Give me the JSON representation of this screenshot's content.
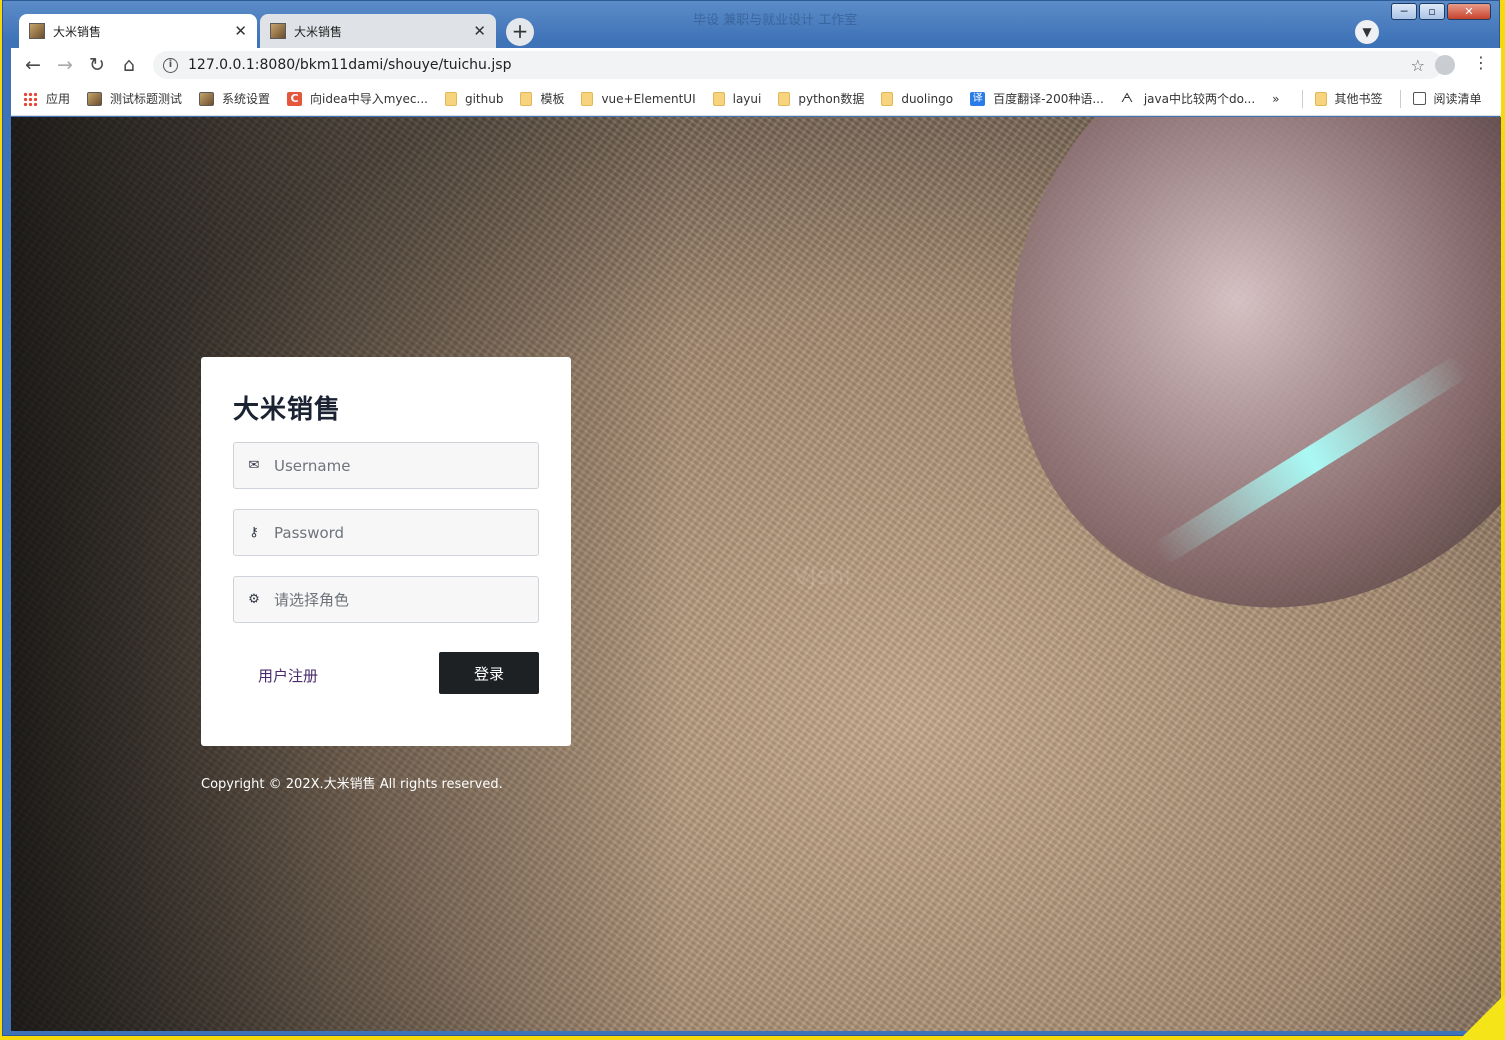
{
  "browser": {
    "window_title": "毕设 兼职与就业设计 工作室",
    "window_controls": [
      "─",
      "▫",
      "✕"
    ],
    "tabs": [
      {
        "label": "大米销售",
        "close": "✕"
      },
      {
        "label": "大米销售",
        "close": "✕"
      }
    ],
    "new_tab": "+",
    "url": "127.0.0.1:8080/bkm11dami/shouye/tuichu.jsp",
    "bookmarks": [
      {
        "label": "应用",
        "icon": "apps-grid-icon"
      },
      {
        "label": "测试标题测试",
        "icon": "page-favicon"
      },
      {
        "label": "系统设置",
        "icon": "page-favicon"
      },
      {
        "label": "向idea中导入myec...",
        "icon": "csdn-icon"
      },
      {
        "label": "github",
        "icon": "folder-icon"
      },
      {
        "label": "模板",
        "icon": "folder-icon"
      },
      {
        "label": "vue+ElementUI",
        "icon": "folder-icon"
      },
      {
        "label": "layui",
        "icon": "folder-icon"
      },
      {
        "label": "python数据",
        "icon": "folder-icon"
      },
      {
        "label": "duolingo",
        "icon": "folder-icon"
      },
      {
        "label": "百度翻译-200种语...",
        "icon": "translate-icon"
      },
      {
        "label": "java中比较两个do...",
        "icon": "site-logo-icon"
      }
    ],
    "bookmarks_more": "»",
    "other_bookmarks": "其他书签",
    "reading_list": "阅读清单"
  },
  "page": {
    "watermark": "VJshi",
    "login": {
      "title": "大米销售",
      "username_placeholder": "Username",
      "password_placeholder": "Password",
      "role_placeholder": "请选择角色",
      "register_link": "用户注册",
      "login_button": "登录"
    },
    "copyright": "Copyright © 202X.大米销售 All rights reserved."
  }
}
